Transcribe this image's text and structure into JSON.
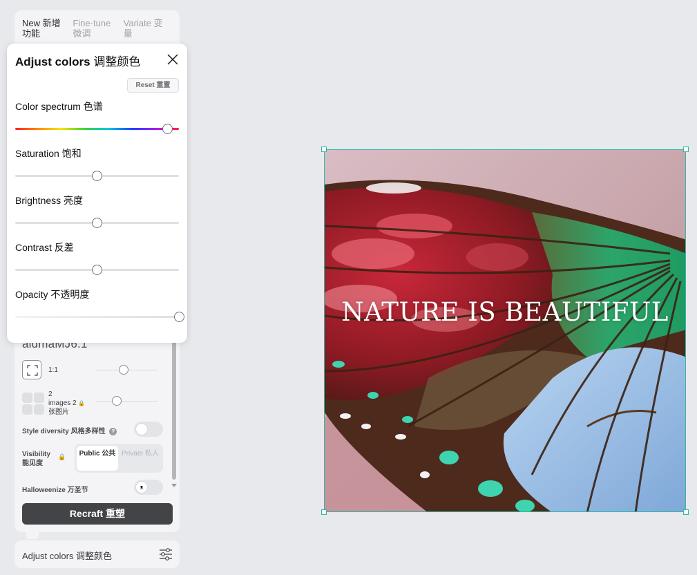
{
  "tabs": [
    {
      "label": "New 新增功能",
      "active": true
    },
    {
      "label": "Fine-tune 微调",
      "active": false
    },
    {
      "label": "Variate 变量",
      "active": false
    }
  ],
  "adjust_popup": {
    "title_en": "Adjust colors",
    "title_zh": "调整颜色",
    "reset_label": "Reset 重置",
    "sliders": [
      {
        "label": "Color spectrum 色谱",
        "value": 0.93
      },
      {
        "label": "Saturation 饱和",
        "value": 0.5
      },
      {
        "label": "Brightness 亮度",
        "value": 0.5
      },
      {
        "label": "Contrast 反差",
        "value": 0.5
      },
      {
        "label": "Opacity 不透明度",
        "value": 1.0
      }
    ]
  },
  "settings": {
    "model_name": "aidmaMJ6.1",
    "aspect_ratio": "1:1",
    "images_line1": "2",
    "images_line2": "images 2",
    "images_line3": "张图片",
    "style_diversity": "Style diversity 风格多样性",
    "visibility_line1": "Visibility",
    "visibility_line2": "能见度",
    "public_label": "Public 公共",
    "private_label": "Private 私人",
    "halloweenize": "Halloweenize 万圣节",
    "recraft_button": "Recraft  重塑"
  },
  "adjust_bar_label": "Adjust colors 调整颜色",
  "artwork": {
    "overlay_text": "NATURE IS BEAUTIFUL"
  },
  "colors": {
    "selection": "#32b8a5",
    "primary_button": "#434448"
  }
}
